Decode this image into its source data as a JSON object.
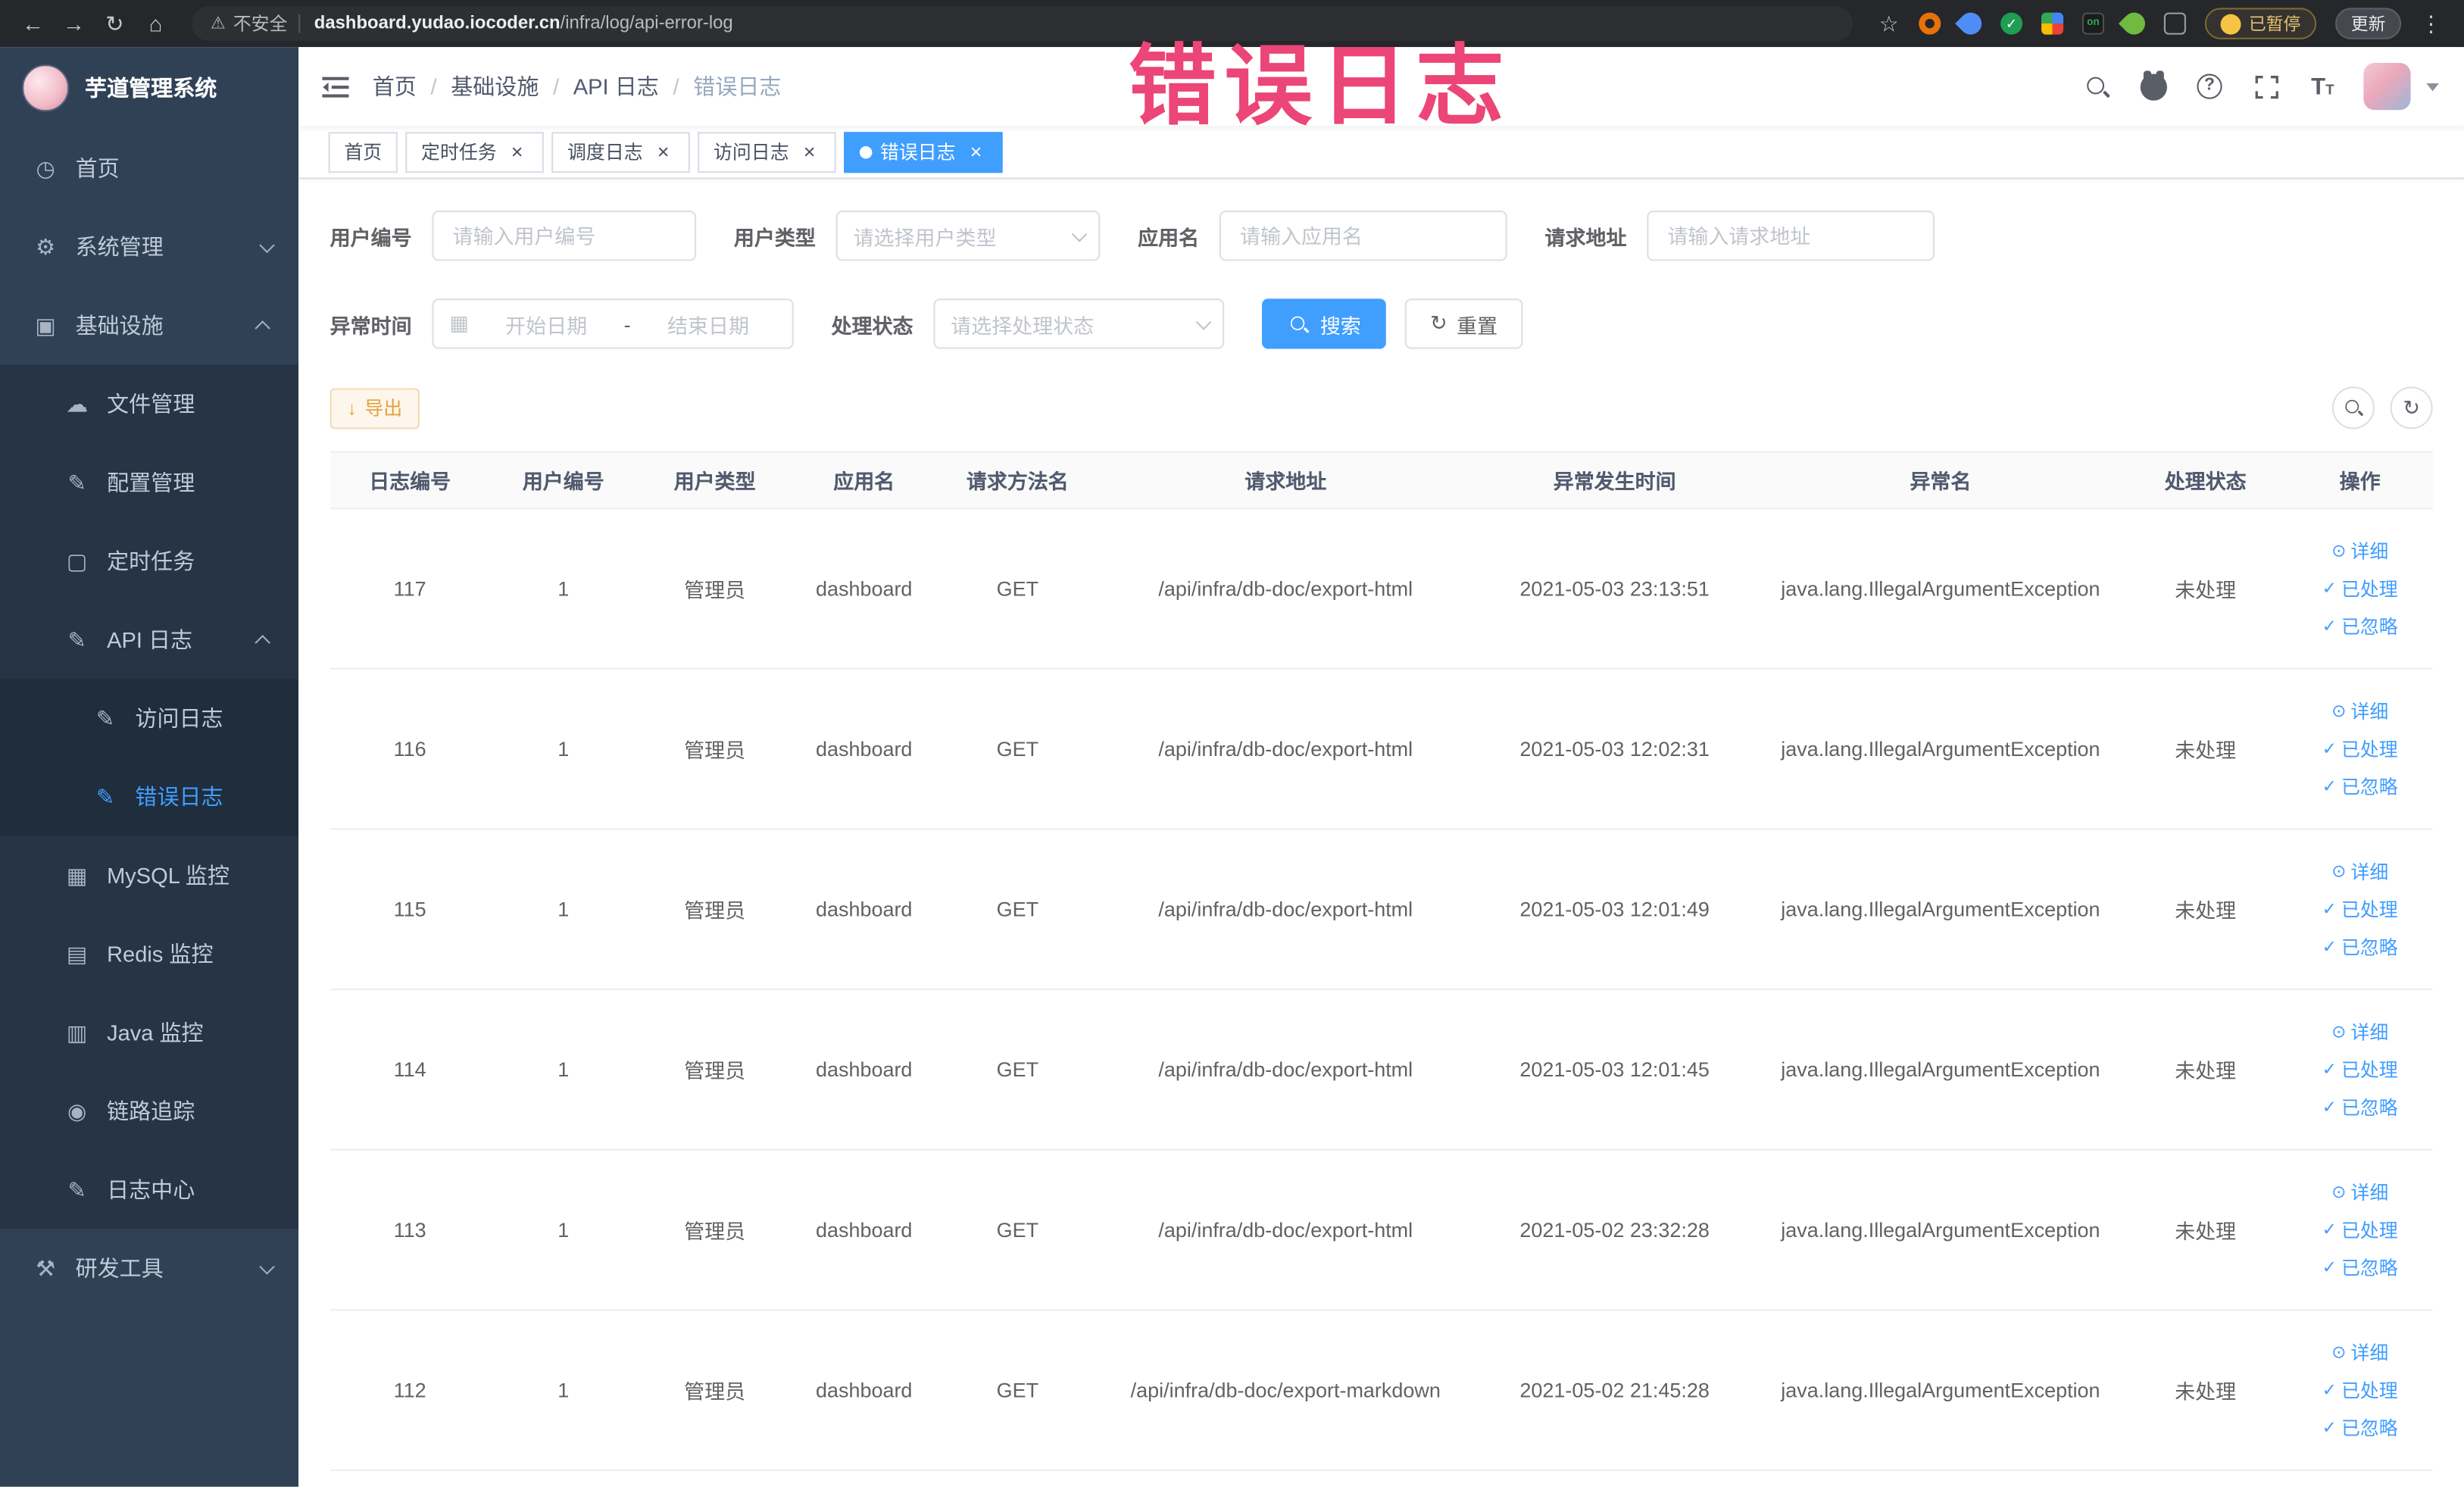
{
  "annotation": {
    "text": "错误日志",
    "color": "#ec4577"
  },
  "colors": {
    "accent": "#409eff",
    "warning": "#e6a23c",
    "sidebar_bg": "#304156"
  },
  "browser": {
    "security_label": "不安全",
    "url_host": "dashboard.yudao.iocoder.cn",
    "url_path": "/infra/log/api-error-log",
    "paused_badge": "已暂停",
    "update_button": "更新",
    "extension_badge_on": "on",
    "extension_check": "✓"
  },
  "sidebar": {
    "logo_title": "芋道管理系统",
    "items": [
      {
        "key": "home",
        "label": "首页",
        "icon": "dashboard",
        "depth": 0
      },
      {
        "key": "system",
        "label": "系统管理",
        "icon": "gear",
        "depth": 0,
        "arrow": "down"
      },
      {
        "key": "infra",
        "label": "基础设施",
        "icon": "monitor",
        "depth": 0,
        "arrow": "up"
      },
      {
        "key": "file",
        "label": "文件管理",
        "icon": "cloud",
        "depth": 1
      },
      {
        "key": "config",
        "label": "配置管理",
        "icon": "edit",
        "depth": 1
      },
      {
        "key": "job",
        "label": "定时任务",
        "icon": "square",
        "depth": 1
      },
      {
        "key": "api-log",
        "label": "API 日志",
        "icon": "edit",
        "depth": 1,
        "arrow": "up"
      },
      {
        "key": "access-log",
        "label": "访问日志",
        "icon": "edit",
        "depth": 2
      },
      {
        "key": "error-log",
        "label": "错误日志",
        "icon": "edit",
        "depth": 2,
        "active": true
      },
      {
        "key": "mysql",
        "label": "MySQL 监控",
        "icon": "grid",
        "depth": 1
      },
      {
        "key": "redis",
        "label": "Redis 监控",
        "icon": "stack",
        "depth": 1
      },
      {
        "key": "java",
        "label": "Java 监控",
        "icon": "screen",
        "depth": 1
      },
      {
        "key": "trace",
        "label": "链路追踪",
        "icon": "eye",
        "depth": 1
      },
      {
        "key": "log-center",
        "label": "日志中心",
        "icon": "edit",
        "depth": 1
      },
      {
        "key": "dev-tools",
        "label": "研发工具",
        "icon": "tools",
        "depth": 0,
        "arrow": "down"
      }
    ]
  },
  "icons": {
    "dashboard": "◷",
    "gear": "⚙",
    "monitor": "▣",
    "cloud": "☁",
    "edit": "✎",
    "square": "▢",
    "grid": "▦",
    "stack": "▤",
    "screen": "▥",
    "eye": "◉",
    "tools": "⚒"
  },
  "header": {
    "breadcrumb": [
      "首页",
      "基础设施",
      "API 日志",
      "错误日志"
    ]
  },
  "tabs": [
    {
      "key": "home",
      "label": "首页",
      "closable": false,
      "active": false
    },
    {
      "key": "job",
      "label": "定时任务",
      "closable": true,
      "active": false
    },
    {
      "key": "job-log",
      "label": "调度日志",
      "closable": true,
      "active": false
    },
    {
      "key": "access-log",
      "label": "访问日志",
      "closable": true,
      "active": false
    },
    {
      "key": "error-log",
      "label": "错误日志",
      "closable": true,
      "active": true
    }
  ],
  "filters": {
    "user_id": {
      "label": "用户编号",
      "placeholder": "请输入用户编号"
    },
    "user_type": {
      "label": "用户类型",
      "placeholder": "请选择用户类型"
    },
    "app_name": {
      "label": "应用名",
      "placeholder": "请输入应用名"
    },
    "request_url": {
      "label": "请求地址",
      "placeholder": "请输入请求地址"
    },
    "exception_time": {
      "label": "异常时间",
      "start_placeholder": "开始日期",
      "separator": "-",
      "end_placeholder": "结束日期"
    },
    "process_status": {
      "label": "处理状态",
      "placeholder": "请选择处理状态"
    },
    "search_button": "搜索",
    "reset_button": "重置"
  },
  "toolbar": {
    "export_label": "导出"
  },
  "table": {
    "columns": [
      "日志编号",
      "用户编号",
      "用户类型",
      "应用名",
      "请求方法名",
      "请求地址",
      "异常发生时间",
      "异常名",
      "处理状态",
      "操作"
    ],
    "actions": [
      {
        "key": "detail",
        "icon": "⊙",
        "label": "详细"
      },
      {
        "key": "processed",
        "icon": "✓",
        "label": "已处理"
      },
      {
        "key": "ignored",
        "icon": "✓",
        "label": "已忽略"
      }
    ],
    "rows": [
      {
        "id": "117",
        "user_id": "1",
        "user_type": "管理员",
        "app": "dashboard",
        "method": "GET",
        "url": "/api/infra/db-doc/export-html",
        "time": "2021-05-03 23:13:51",
        "exception": "java.lang.IllegalArgumentException",
        "status": "未处理"
      },
      {
        "id": "116",
        "user_id": "1",
        "user_type": "管理员",
        "app": "dashboard",
        "method": "GET",
        "url": "/api/infra/db-doc/export-html",
        "time": "2021-05-03 12:02:31",
        "exception": "java.lang.IllegalArgumentException",
        "status": "未处理"
      },
      {
        "id": "115",
        "user_id": "1",
        "user_type": "管理员",
        "app": "dashboard",
        "method": "GET",
        "url": "/api/infra/db-doc/export-html",
        "time": "2021-05-03 12:01:49",
        "exception": "java.lang.IllegalArgumentException",
        "status": "未处理"
      },
      {
        "id": "114",
        "user_id": "1",
        "user_type": "管理员",
        "app": "dashboard",
        "method": "GET",
        "url": "/api/infra/db-doc/export-html",
        "time": "2021-05-03 12:01:45",
        "exception": "java.lang.IllegalArgumentException",
        "status": "未处理"
      },
      {
        "id": "113",
        "user_id": "1",
        "user_type": "管理员",
        "app": "dashboard",
        "method": "GET",
        "url": "/api/infra/db-doc/export-html",
        "time": "2021-05-02 23:32:28",
        "exception": "java.lang.IllegalArgumentException",
        "status": "未处理"
      },
      {
        "id": "112",
        "user_id": "1",
        "user_type": "管理员",
        "app": "dashboard",
        "method": "GET",
        "url": "/api/infra/db-doc/export-markdown",
        "time": "2021-05-02 21:45:28",
        "exception": "java.lang.IllegalArgumentException",
        "status": "未处理"
      }
    ]
  }
}
